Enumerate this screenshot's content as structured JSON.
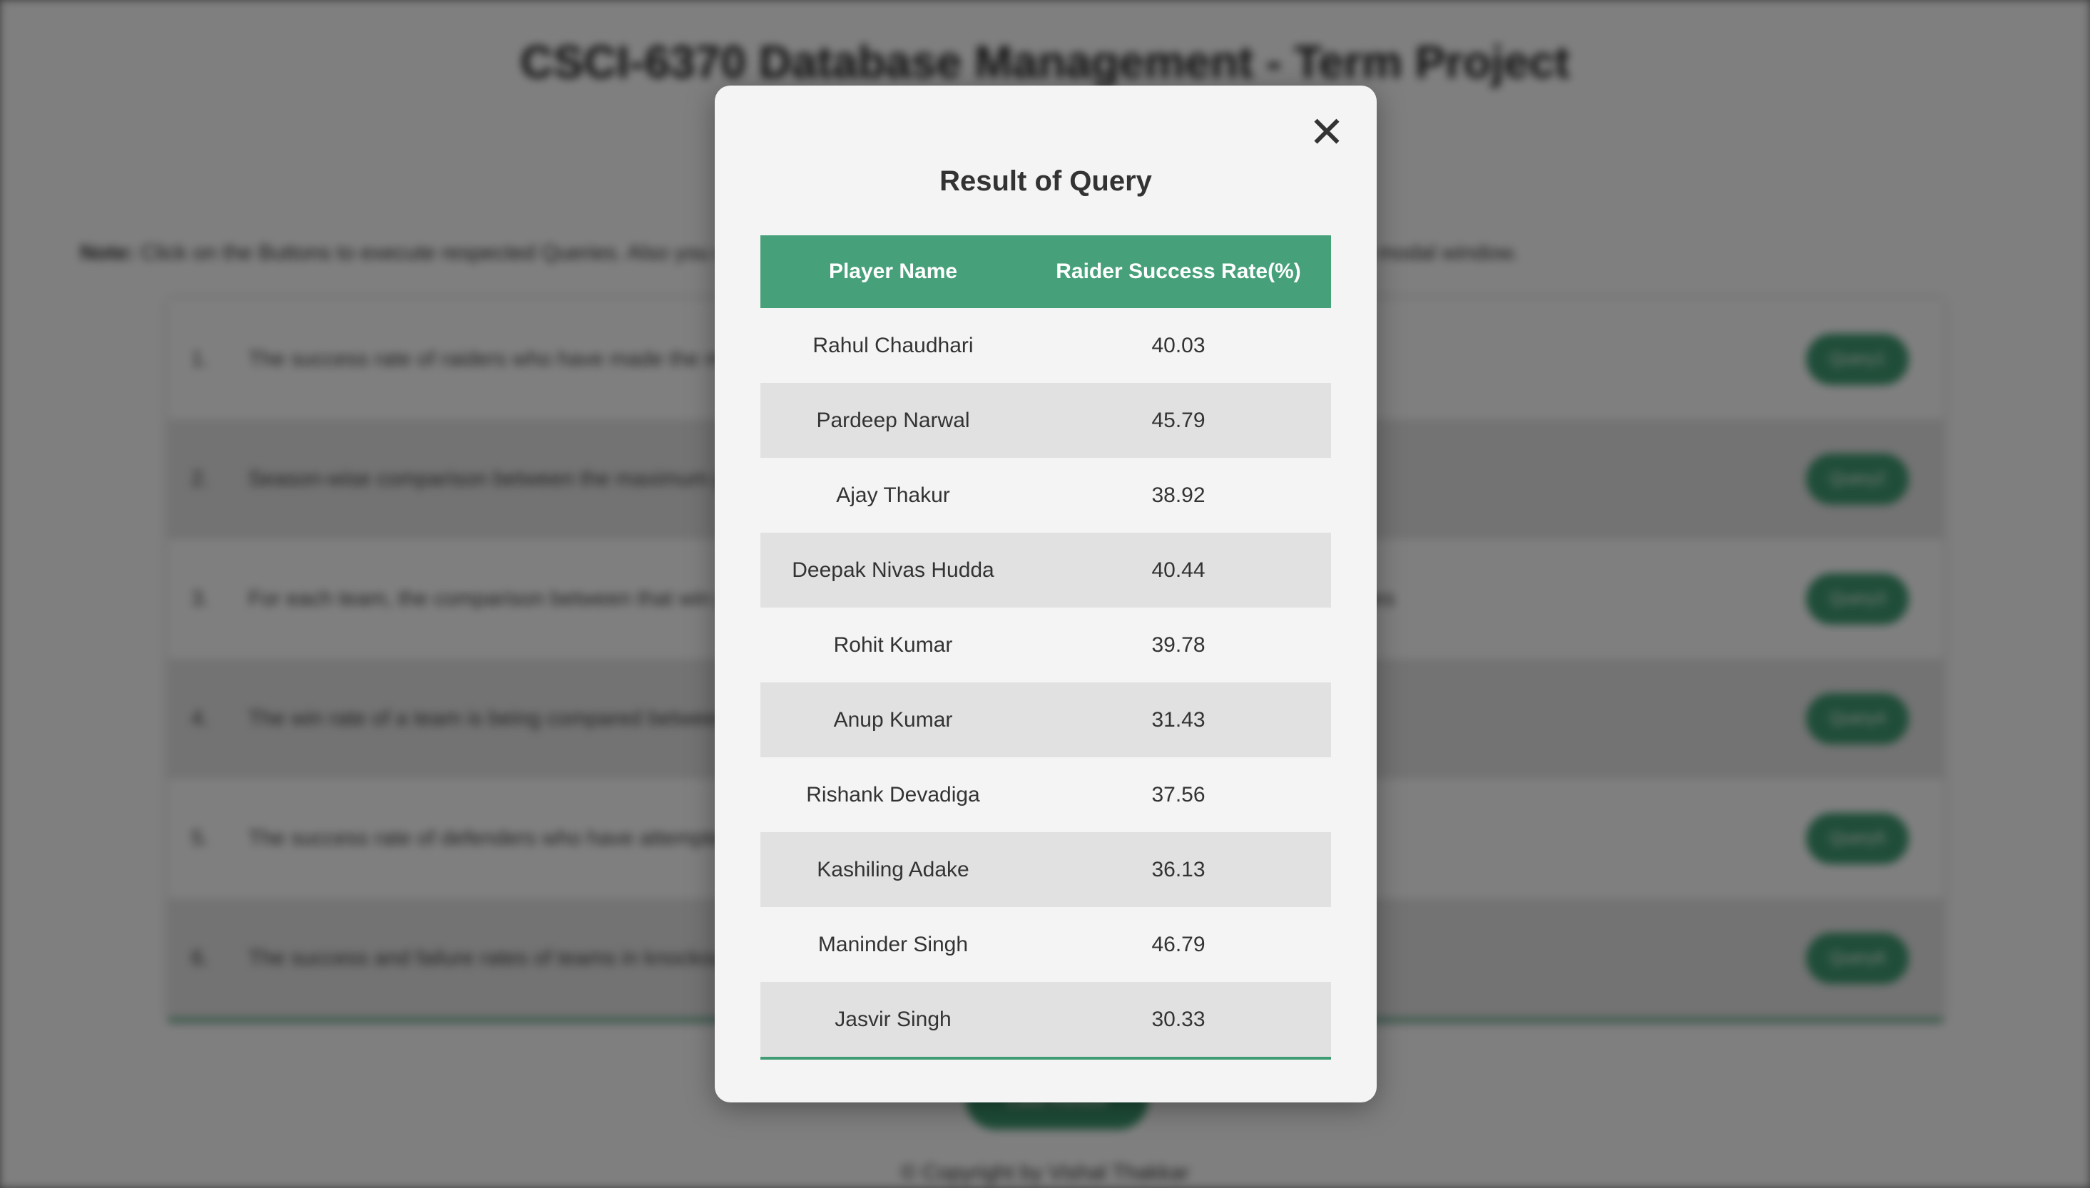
{
  "page": {
    "title": "CSCI-6370 Database Management - Term Project",
    "note_label": "Note:",
    "note_text": "Click on the Buttons to execute respected Queries. Also you can view the result of recently executed query in case if you close the modal window.",
    "queries": [
      {
        "num": "1.",
        "text": "The success rate of raiders who have made the most raids",
        "button": "Query1"
      },
      {
        "num": "2.",
        "text": "Season-wise comparison between the maximum points scored",
        "button": "Query2"
      },
      {
        "num": "3.",
        "text": "For each team, the comparison between that win percentage at home matches and that win percentage at away matches",
        "button": "Query3"
      },
      {
        "num": "4.",
        "text": "The win rate of a team is being compared between matches",
        "button": "Query4"
      },
      {
        "num": "5.",
        "text": "The success rate of defenders who have attempted",
        "button": "Query5"
      },
      {
        "num": "6.",
        "text": "The success and failure rates of teams in knockout",
        "button": "Query6"
      }
    ],
    "last_result_button": "Last Result",
    "footer": "© Copyright by Vishal Thakkar"
  },
  "modal": {
    "close_label": "✕",
    "title": "Result of Query",
    "headers": [
      "Player Name",
      "Raider Success Rate(%)"
    ],
    "rows": [
      [
        "Rahul Chaudhari",
        "40.03"
      ],
      [
        "Pardeep Narwal",
        "45.79"
      ],
      [
        "Ajay Thakur",
        "38.92"
      ],
      [
        "Deepak Nivas Hudda",
        "40.44"
      ],
      [
        "Rohit Kumar",
        "39.78"
      ],
      [
        "Anup Kumar",
        "31.43"
      ],
      [
        "Rishank Devadiga",
        "37.56"
      ],
      [
        "Kashiling Adake",
        "36.13"
      ],
      [
        "Maninder Singh",
        "46.79"
      ],
      [
        "Jasvir Singh",
        "30.33"
      ]
    ]
  },
  "colors": {
    "accent": "#46a07a",
    "overlay": "rgba(0,0,0,0.5)",
    "modal_bg": "#f4f4f4",
    "stripe": "#e1e1e1"
  }
}
